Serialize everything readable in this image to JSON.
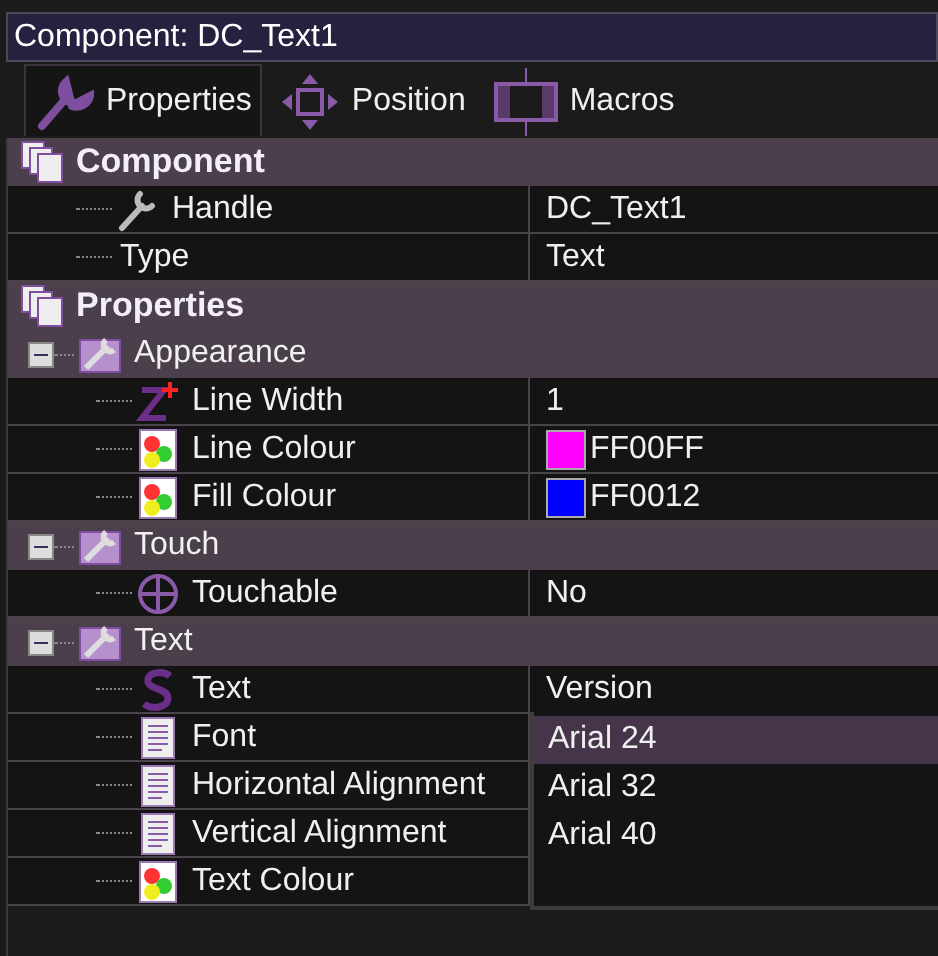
{
  "title": "Component: DC_Text1",
  "tabs": [
    {
      "label": "Properties",
      "selected": true
    },
    {
      "label": "Position",
      "selected": false
    },
    {
      "label": "Macros",
      "selected": false
    }
  ],
  "sections": [
    {
      "label": "Component",
      "children": [
        {
          "kind": "tool",
          "label": "Handle",
          "value": "DC_Text1"
        },
        {
          "kind": "plain",
          "label": "Type",
          "value": "Text"
        }
      ]
    },
    {
      "label": "Properties",
      "children": [
        {
          "kind": "group",
          "label": "Appearance",
          "expanded": true,
          "children": [
            {
              "kind": "z",
              "label": "Line Width",
              "value": "1"
            },
            {
              "kind": "colour",
              "label": "Line Colour",
              "value": "FF00FF",
              "color": "#ff00ff"
            },
            {
              "kind": "colour",
              "label": "Fill Colour",
              "value": "FF0012",
              "color": "#0000ff"
            }
          ]
        },
        {
          "kind": "group",
          "label": "Touch",
          "expanded": true,
          "children": [
            {
              "kind": "touch",
              "label": "Touchable",
              "value": "No"
            }
          ]
        },
        {
          "kind": "group",
          "label": "Text",
          "expanded": true,
          "children": [
            {
              "kind": "s",
              "label": "Text",
              "value": "Version"
            },
            {
              "kind": "doc",
              "label": "Font",
              "dropdown": [
                {
                  "label": "Arial 24",
                  "selected": true
                },
                {
                  "label": "Arial 32",
                  "selected": false
                },
                {
                  "label": "Arial 40",
                  "selected": false
                }
              ]
            },
            {
              "kind": "doc",
              "label": "Horizontal Alignment"
            },
            {
              "kind": "doc",
              "label": "Vertical Alignment"
            },
            {
              "kind": "colour",
              "label": "Text Colour"
            }
          ]
        }
      ]
    }
  ]
}
